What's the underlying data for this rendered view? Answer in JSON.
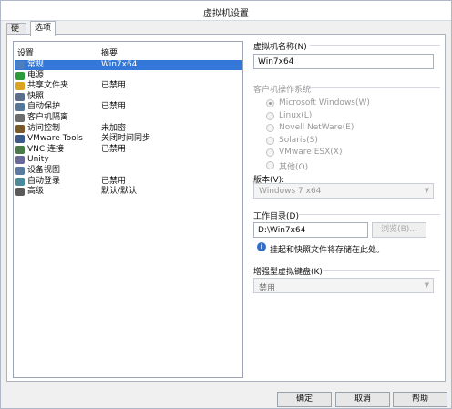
{
  "window": {
    "title": "虚拟机设置"
  },
  "tabs": [
    {
      "label": "硬件"
    },
    {
      "label": "选项"
    }
  ],
  "settings_list": {
    "header": {
      "setting": "设置",
      "summary": "摘要"
    },
    "items": [
      {
        "name": "常规",
        "summary": "Win7x64",
        "icon": "general-icon",
        "selected": true
      },
      {
        "name": "电源",
        "summary": "",
        "icon": "power-icon"
      },
      {
        "name": "共享文件夹",
        "summary": "已禁用",
        "icon": "shared-folder-icon"
      },
      {
        "name": "快照",
        "summary": "",
        "icon": "snapshot-icon"
      },
      {
        "name": "自动保护",
        "summary": "已禁用",
        "icon": "autoprotect-icon"
      },
      {
        "name": "客户机隔离",
        "summary": "",
        "icon": "guest-isolation-icon"
      },
      {
        "name": "访问控制",
        "summary": "未加密",
        "icon": "access-control-icon"
      },
      {
        "name": "VMware Tools",
        "summary": "关闭时间同步",
        "icon": "vmware-tools-icon"
      },
      {
        "name": "VNC 连接",
        "summary": "已禁用",
        "icon": "vnc-icon"
      },
      {
        "name": "Unity",
        "summary": "",
        "icon": "unity-icon"
      },
      {
        "name": "设备视图",
        "summary": "",
        "icon": "device-view-icon"
      },
      {
        "name": "自动登录",
        "summary": "已禁用",
        "icon": "autologon-icon"
      },
      {
        "name": "高级",
        "summary": "默认/默认",
        "icon": "advanced-icon"
      }
    ]
  },
  "vm_name": {
    "label": "虚拟机名称(N)",
    "value": "Win7x64"
  },
  "guest_os": {
    "label": "客户机操作系统",
    "options": [
      {
        "label": "Microsoft Windows(W)",
        "checked": true
      },
      {
        "label": "Linux(L)",
        "checked": false
      },
      {
        "label": "Novell NetWare(E)",
        "checked": false
      },
      {
        "label": "Solaris(S)",
        "checked": false
      },
      {
        "label": "VMware ESX(X)",
        "checked": false
      },
      {
        "label": "其他(O)",
        "checked": false
      }
    ],
    "version_label": "版本(V):",
    "version_value": "Windows 7 x64"
  },
  "working_dir": {
    "label": "工作目录(D)",
    "value": "D:\\Win7x64",
    "browse_label": "浏览(B)...",
    "info_text": "挂起和快照文件将存储在此处。"
  },
  "keyboard": {
    "label": "增强型虚拟键盘(K)",
    "value": "禁用"
  },
  "footer": {
    "ok_label": "确定",
    "cancel_label": "取消",
    "help_label": "帮助"
  },
  "colors": {
    "selection": "#3377d9",
    "window_bg": "#f0f0f0",
    "border": "#a9b2be"
  }
}
